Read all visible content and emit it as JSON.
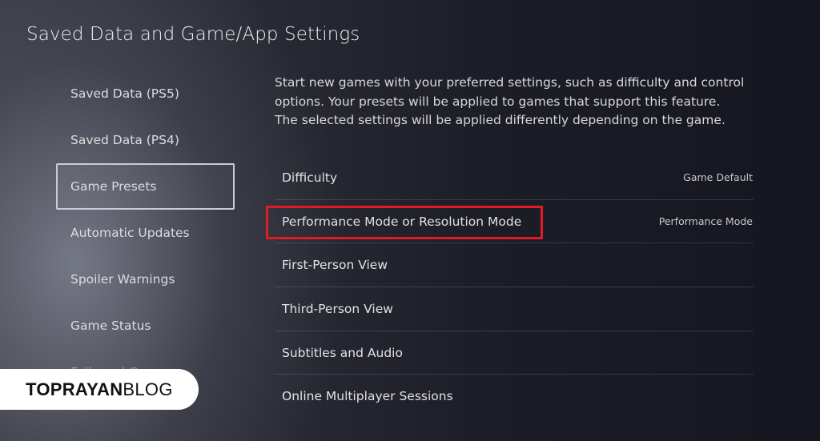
{
  "header": {
    "title": "Saved Data and Game/App Settings"
  },
  "sidebar": {
    "items": [
      {
        "label": "Saved Data (PS5)"
      },
      {
        "label": "Saved Data (PS4)"
      },
      {
        "label": "Game Presets"
      },
      {
        "label": "Automatic Updates"
      },
      {
        "label": "Spoiler Warnings"
      },
      {
        "label": "Game Status"
      },
      {
        "label": "Followed Games"
      }
    ],
    "active_index": 2
  },
  "main": {
    "description": "Start new games with your preferred settings, such as difficulty and control options. Your presets will be applied to games that support this feature. The selected settings will be applied differently depending on the game.",
    "settings": [
      {
        "label": "Difficulty",
        "value": "Game Default"
      },
      {
        "label": "Performance Mode or Resolution Mode",
        "value": "Performance Mode"
      },
      {
        "label": "First-Person View",
        "value": ""
      },
      {
        "label": "Third-Person View",
        "value": ""
      },
      {
        "label": "Subtitles and Audio",
        "value": ""
      },
      {
        "label": "Online Multiplayer Sessions",
        "value": ""
      }
    ]
  },
  "watermark": {
    "bold": "TOPRAYAN",
    "light": "BLOG"
  },
  "colors": {
    "highlight": "#e01b24",
    "background": "#1c1d27",
    "text": "#e6e6e6"
  }
}
